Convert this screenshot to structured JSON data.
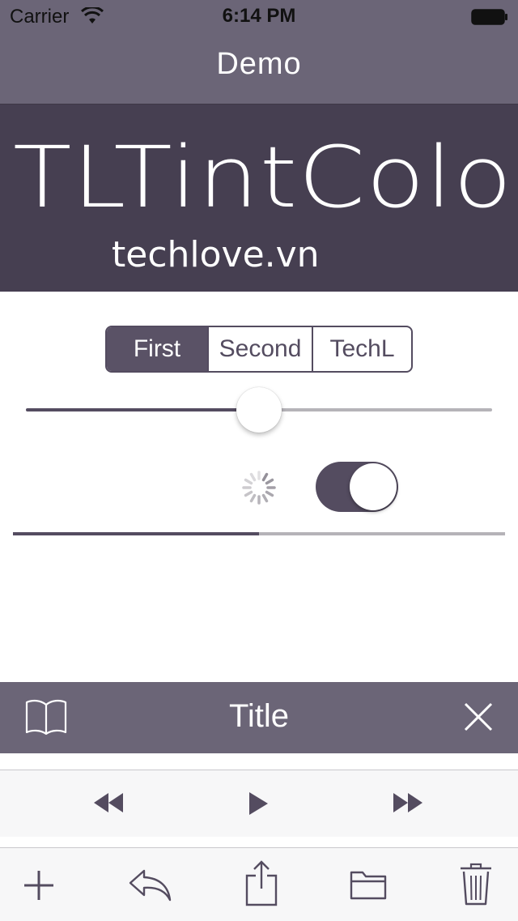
{
  "status_bar": {
    "carrier": "Carrier",
    "time": "6:14 PM",
    "wifi_icon": "wifi-icon",
    "battery_icon": "battery-icon"
  },
  "nav": {
    "title": "Demo"
  },
  "banner": {
    "title": "TLTintColor",
    "subtitle": "techlove.vn"
  },
  "segmented": {
    "items": [
      "First",
      "Second",
      "TechL"
    ],
    "selected": "First"
  },
  "slider": {
    "value": 0.5
  },
  "activity_indicator": {
    "animating": true
  },
  "switch": {
    "on": true
  },
  "progress": {
    "value": 0.5
  },
  "second_bar": {
    "title": "Title",
    "left_icon": "book-icon",
    "right_icon": "close-icon"
  },
  "player": {
    "icons": [
      "rewind-icon",
      "play-icon",
      "fast-forward-icon"
    ]
  },
  "toolbar": {
    "icons": [
      "add-icon",
      "reply-icon",
      "share-icon",
      "folder-icon",
      "trash-icon"
    ]
  },
  "colors": {
    "tint": "#544c60",
    "bar_background": "#6b6577",
    "banner_background": "#463f51",
    "text_on_bar": "#ffffff"
  }
}
